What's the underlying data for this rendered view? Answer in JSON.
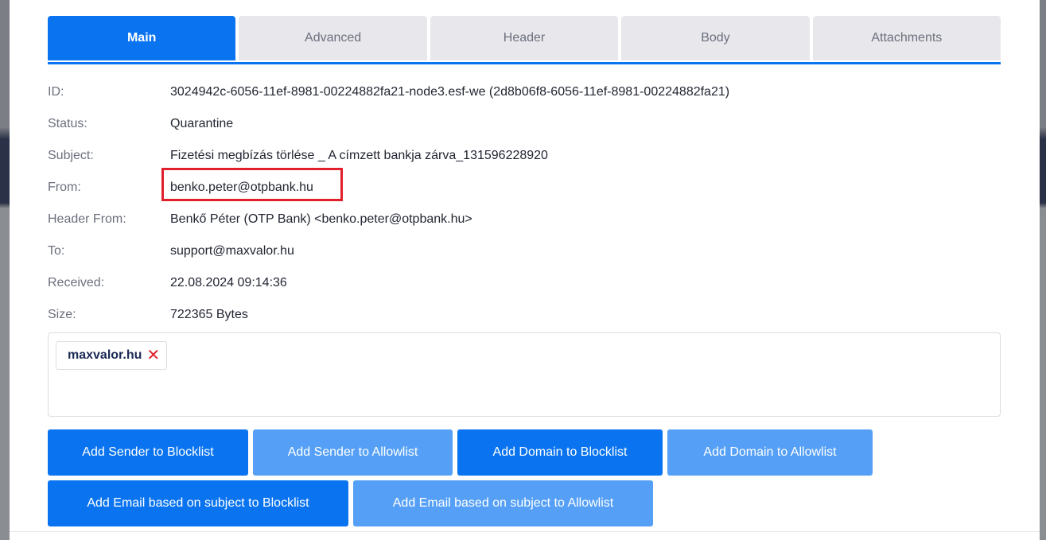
{
  "tabs": [
    {
      "label": "Main",
      "active": true
    },
    {
      "label": "Advanced",
      "active": false
    },
    {
      "label": "Header",
      "active": false
    },
    {
      "label": "Body",
      "active": false
    },
    {
      "label": "Attachments",
      "active": false
    }
  ],
  "fields": {
    "id": {
      "label": "ID:",
      "value": "3024942c-6056-11ef-8981-00224882fa21-node3.esf-we (2d8b06f8-6056-11ef-8981-00224882fa21)"
    },
    "status": {
      "label": "Status:",
      "value": "Quarantine"
    },
    "subject": {
      "label": "Subject:",
      "value": "Fizetési megbízás törlése _ A címzett bankja zárva_131596228920"
    },
    "from": {
      "label": "From:",
      "value": "benko.peter@otpbank.hu"
    },
    "header_from": {
      "label": "Header From:",
      "value": "Benkő Péter (OTP Bank) <benko.peter@otpbank.hu>"
    },
    "to": {
      "label": "To:",
      "value": "support@maxvalor.hu"
    },
    "received": {
      "label": "Received:",
      "value": "22.08.2024 09:14:36"
    },
    "size": {
      "label": "Size:",
      "value": "722365 Bytes"
    }
  },
  "tags": [
    {
      "label": "maxvalor.hu",
      "remove_glyph": "✕"
    }
  ],
  "buttons": {
    "sender_blocklist": "Add Sender to Blocklist",
    "sender_allowlist": "Add Sender to Allowlist",
    "domain_blocklist": "Add Domain to Blocklist",
    "domain_allowlist": "Add Domain to Allowlist",
    "subject_blocklist": "Add Email based on subject to Blocklist",
    "subject_allowlist": "Add Email based on subject to Allowlist"
  },
  "colors": {
    "primary": "#0a74f0",
    "primary_light": "#55a0f6",
    "highlight": "#e0202a"
  },
  "icons": {
    "tag_remove": "close-icon"
  }
}
